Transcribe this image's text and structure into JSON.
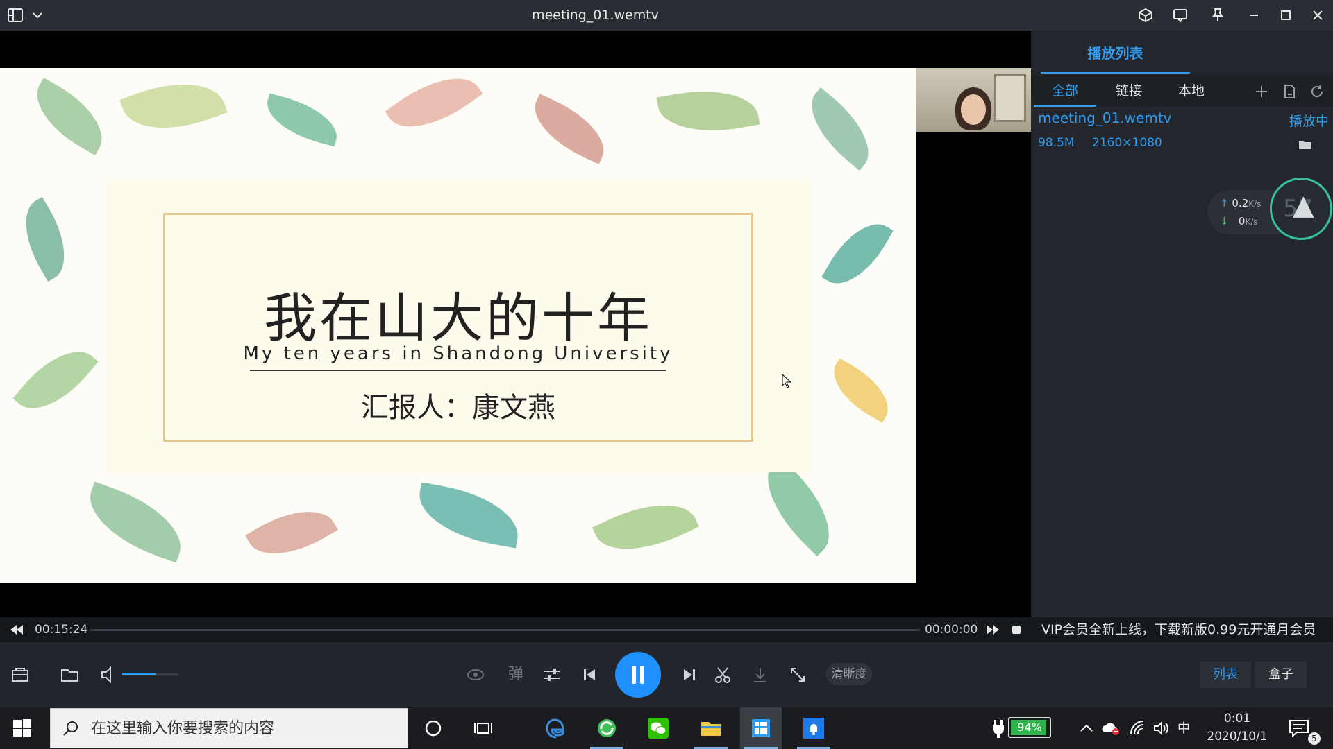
{
  "window": {
    "title": "meeting_01.wemtv"
  },
  "slide": {
    "title": "我在山大的十年",
    "subtitle": "My ten years in Shandong University",
    "reporter": "汇报人：康文燕"
  },
  "playlist": {
    "header": "播放列表",
    "tabs": [
      {
        "label": "全部"
      },
      {
        "label": "链接"
      },
      {
        "label": "本地"
      }
    ],
    "item": {
      "name": "meeting_01.wemtv",
      "status": "播放中",
      "size": "98.5M",
      "resolution": "2160×1080"
    }
  },
  "network": {
    "up_value": "0.2",
    "up_unit": "K/s",
    "down_value": "0",
    "down_unit": "K/s",
    "dial_value": "57"
  },
  "progress": {
    "current_time": "00:15:24",
    "end_time": "00:00:00",
    "fraction": 0.0
  },
  "promo": {
    "text": "VIP会员全新上线，下载新版0.99元开通月会员"
  },
  "controls": {
    "danmaku_label": "弹",
    "quality_label": "清晰度",
    "list_label": "列表",
    "box_label": "盒子",
    "volume_level": 0.6
  },
  "taskbar": {
    "search_placeholder": "在这里输入你要搜索的内容",
    "battery": "94%",
    "battery_level": 0.94,
    "ime": "中",
    "time": "0:01",
    "date": "2020/10/1",
    "notifications": "5"
  },
  "colors": {
    "accent": "#2f9cf0",
    "play": "#1e90ff",
    "battery": "#2db34a"
  }
}
